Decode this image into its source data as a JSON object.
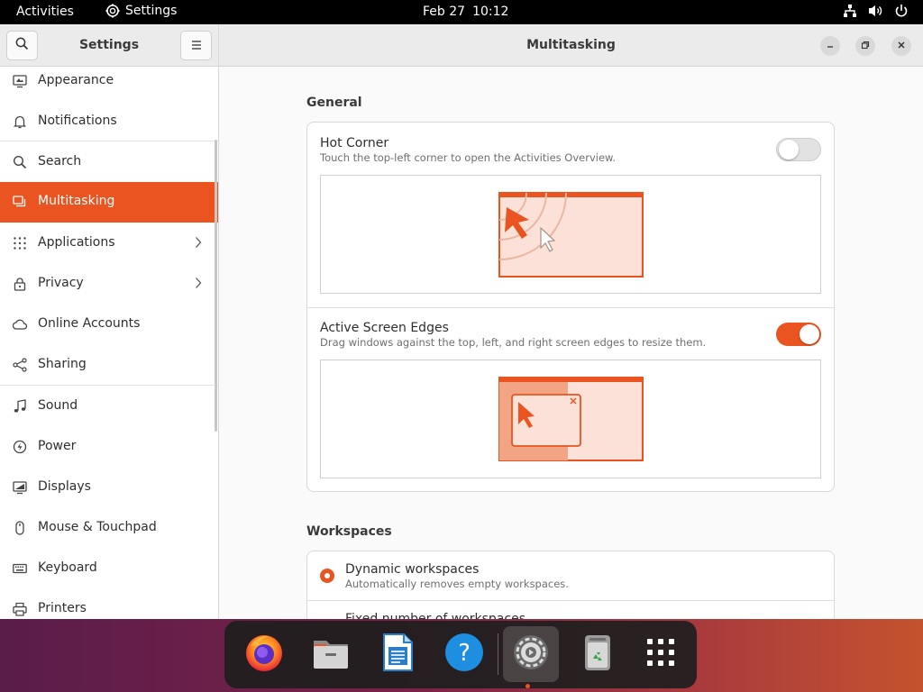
{
  "topbar": {
    "activities": "Activities",
    "app_name": "Settings",
    "date": "Feb 27",
    "time": "10:12"
  },
  "sidebar": {
    "title": "Settings",
    "items": [
      {
        "label": "Appearance",
        "icon": "appearance-icon"
      },
      {
        "label": "Notifications",
        "icon": "bell-icon"
      },
      {
        "label": "Search",
        "icon": "search-icon"
      },
      {
        "label": "Multitasking",
        "icon": "multitasking-icon",
        "active": true
      },
      {
        "label": "Applications",
        "icon": "apps-grid-icon",
        "has_submenu": true
      },
      {
        "label": "Privacy",
        "icon": "lock-icon",
        "has_submenu": true
      },
      {
        "label": "Online Accounts",
        "icon": "cloud-icon"
      },
      {
        "label": "Sharing",
        "icon": "share-icon"
      },
      {
        "label": "Sound",
        "icon": "music-note-icon"
      },
      {
        "label": "Power",
        "icon": "power-icon"
      },
      {
        "label": "Displays",
        "icon": "display-icon"
      },
      {
        "label": "Mouse & Touchpad",
        "icon": "mouse-icon"
      },
      {
        "label": "Keyboard",
        "icon": "keyboard-icon"
      },
      {
        "label": "Printers",
        "icon": "printer-icon"
      }
    ]
  },
  "content": {
    "title": "Multitasking",
    "general": {
      "heading": "General",
      "hot_corner": {
        "title": "Hot Corner",
        "subtitle": "Touch the top-left corner to open the Activities Overview.",
        "enabled": false
      },
      "active_edges": {
        "title": "Active Screen Edges",
        "subtitle": "Drag windows against the top, left, and right screen edges to resize them.",
        "enabled": true
      }
    },
    "workspaces": {
      "heading": "Workspaces",
      "dynamic": {
        "title": "Dynamic workspaces",
        "subtitle": "Automatically removes empty workspaces.",
        "selected": true
      },
      "fixed": {
        "title": "Fixed number of workspaces"
      }
    }
  },
  "dock": {
    "items": [
      "firefox-icon",
      "files-icon",
      "writer-icon",
      "help-icon",
      "settings-icon",
      "trash-icon",
      "app-grid-icon"
    ],
    "running": "settings-icon"
  },
  "colors": {
    "accent": "#e95420",
    "topbar": "#000000",
    "sidebar_bg": "#ffffff",
    "content_bg": "#fafafa"
  }
}
